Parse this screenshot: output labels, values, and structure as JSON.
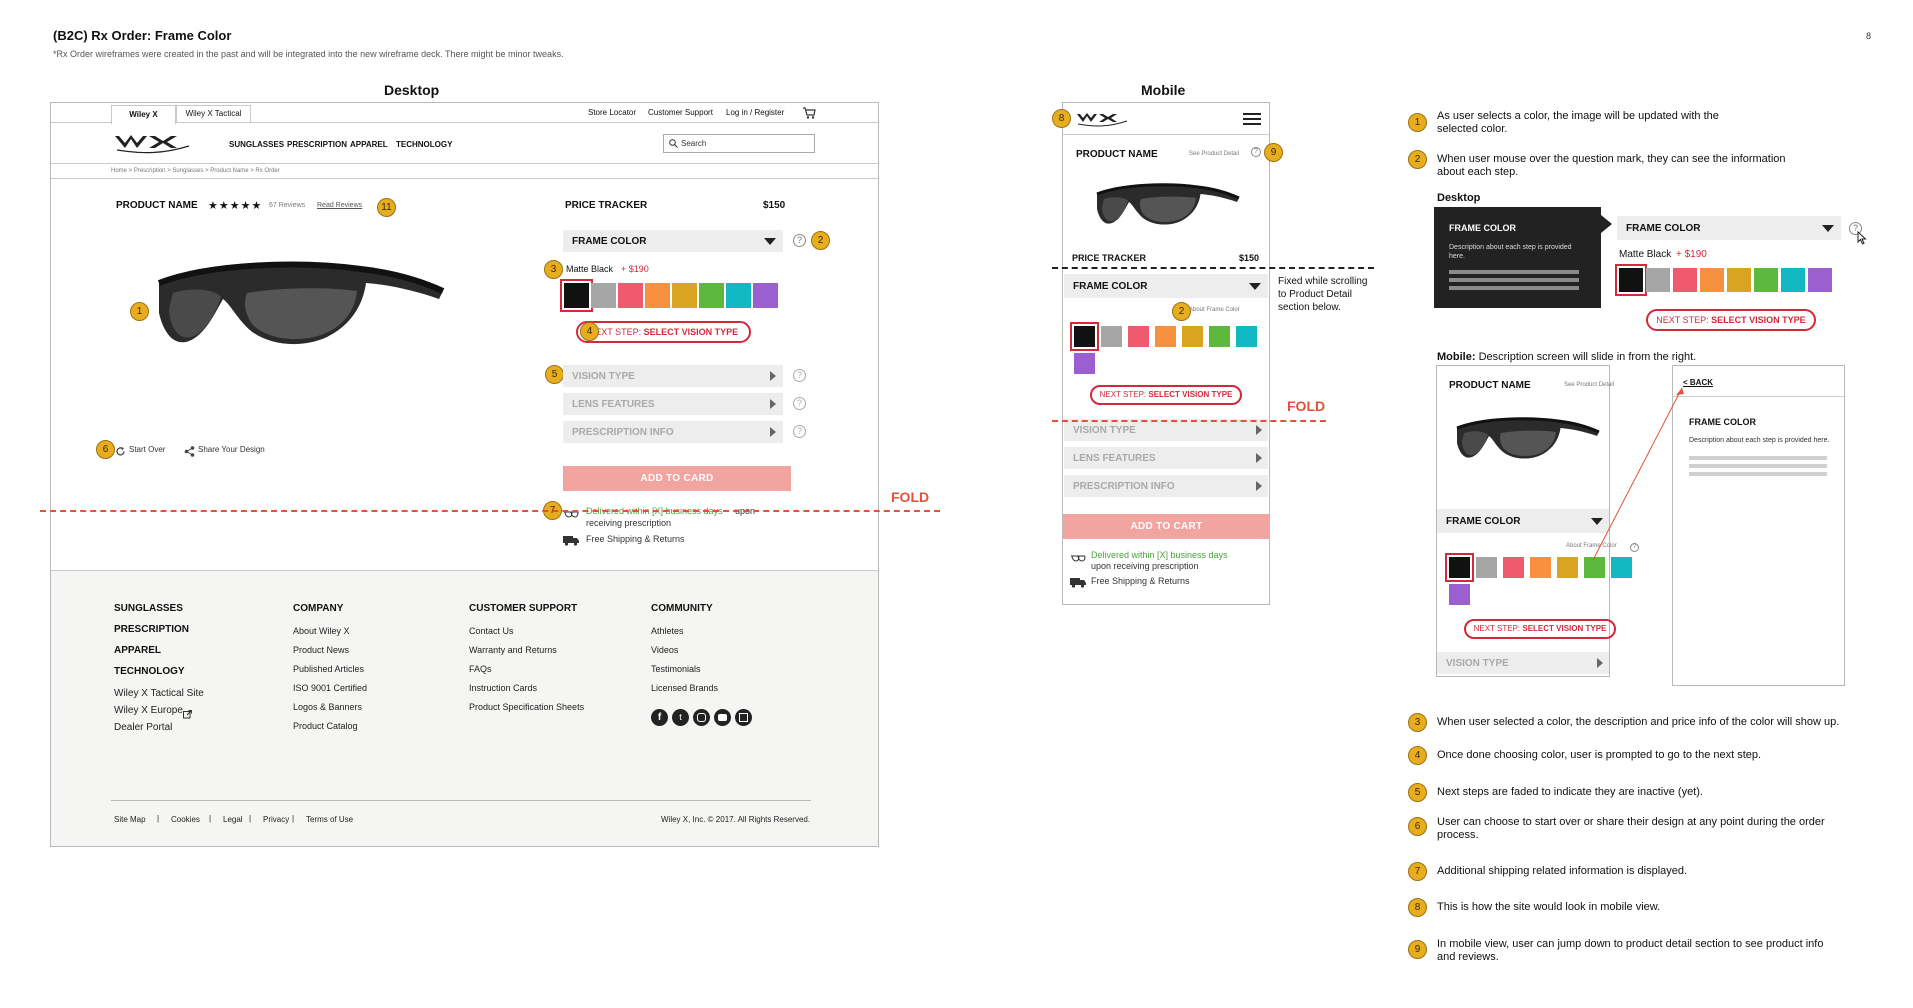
{
  "page": {
    "title": "(B2C) Rx Order: Frame Color",
    "subtitle": "*Rx Order wireframes were created in the past and will be integrated into the new wireframe deck. There might be minor tweaks.",
    "page_number": "8"
  },
  "colors": {
    "accent_red": "#d4283b",
    "badge_yellow": "#e7ad1e",
    "add_button": "#f2a4a1",
    "green_text": "#4aa13b",
    "fold": "#e2523a"
  },
  "swatches": [
    "#111111",
    "#a6a6a6",
    "#ef5a6f",
    "#f7903f",
    "#d9a421",
    "#5db93e",
    "#12b9c3",
    "#9c5fcf"
  ],
  "desktop": {
    "heading": "Desktop",
    "topnav": {
      "tabs": [
        "Wiley X",
        "Wiley X Tactical"
      ],
      "links": [
        "Store Locator",
        "Customer Support",
        "Log in / Register"
      ],
      "cart_icon": "cart-icon"
    },
    "mainnav": {
      "logo": "WX",
      "items": [
        "SUNGLASSES",
        "PRESCRIPTION",
        "APPAREL",
        "TECHNOLOGY"
      ],
      "search_placeholder": "Search"
    },
    "breadcrumb": "Home  >  Prescription  >  Sunglasses  >  Product Name  >  Rx Order",
    "product": {
      "name": "PRODUCT NAME",
      "stars": "★★★★★",
      "reviews": "67 Reviews",
      "read_reviews": "Read Reviews",
      "start_over": "Start Over",
      "share": "Share Your Design"
    },
    "tracker": {
      "label": "PRICE TRACKER",
      "price": "$150",
      "frame_color": "FRAME COLOR",
      "color_name": "Matte Black",
      "color_price": "+ $190",
      "next_step_prefix": "NEXT STEP:",
      "next_step_action": "SELECT VISION TYPE",
      "steps": [
        "VISION TYPE",
        "LENS FEATURES",
        "PRESCRIPTION INFO"
      ],
      "add_button": "ADD TO CARD",
      "delivery_green": "Delivered within [X] business days",
      "delivery_rest": "upon",
      "delivery_line2": "receiving prescription",
      "shipping": "Free Shipping & Returns"
    },
    "fold": "FOLD",
    "footer": {
      "col1": [
        "SUNGLASSES",
        "PRESCRIPTION",
        "APPAREL",
        "TECHNOLOGY"
      ],
      "col1_links": [
        "Wiley X Tactical Site",
        "Wiley X Europe",
        "Dealer Portal"
      ],
      "col2_title": "COMPANY",
      "col2": [
        "About Wiley X",
        "Product News",
        "Published Articles",
        "ISO 9001 Certified",
        "Logos & Banners",
        "Product Catalog"
      ],
      "col3_title": "CUSTOMER SUPPORT",
      "col3": [
        "Contact Us",
        "Warranty and Returns",
        "FAQs",
        "Instruction Cards",
        "Product Specification Sheets"
      ],
      "col4_title": "COMMUNITY",
      "col4": [
        "Athletes",
        "Videos",
        "Testimonials",
        "Licensed Brands"
      ],
      "bottom_links": [
        "Site Map",
        "Cookies",
        "Legal",
        "Privacy",
        "Terms of Use"
      ],
      "copyright": "Wiley X, Inc. © 2017. All Rights Reserved."
    }
  },
  "mobile": {
    "heading": "Mobile",
    "product_name": "PRODUCT NAME",
    "see_detail": "See Product Detail",
    "tracker": "PRICE TRACKER",
    "price": "$150",
    "sticky_note": "Fixed while scrolling to Product Detail section below.",
    "frame_color": "FRAME COLOR",
    "about": "About Frame Color",
    "next_step_prefix": "NEXT STEP:",
    "next_step_action": "SELECT VISION TYPE",
    "fold": "FOLD",
    "steps": [
      "VISION TYPE",
      "LENS FEATURES",
      "PRESCRIPTION INFO"
    ],
    "add_button": "ADD TO CART",
    "delivery_green": "Delivered within [X] business days",
    "delivery_line2": "upon receiving prescription",
    "shipping": "Free Shipping & Returns"
  },
  "notes": {
    "n1": "As user selects a color, the image will be updated with the selected color.",
    "n2": "When user mouse over the question mark, they can see the information about each step.",
    "desktop_label": "Desktop",
    "tooltip_title": "FRAME COLOR",
    "tooltip_desc": "Description about each step is provided here.",
    "mobile_label": "Mobile:",
    "mobile_desc": "Description screen will slide in from the right.",
    "back": "< BACK",
    "panel_title": "FRAME COLOR",
    "panel_desc": "Description about each step is provided here.",
    "n3": "When user selected a color, the description and price info of the color will show up.",
    "n4": "Once done choosing color, user is prompted to go to the next step.",
    "n5": "Next steps are faded to indicate they are inactive (yet).",
    "n6": "User can choose to start over or share their design at any point during the order process.",
    "n7": "Additional shipping related information is displayed.",
    "n8": "This is how the site would look in mobile view.",
    "n9": "In mobile view, user can jump down to product detail section to see product info and reviews."
  },
  "badges": [
    "1",
    "2",
    "3",
    "4",
    "5",
    "6",
    "7",
    "8",
    "9",
    "11"
  ]
}
